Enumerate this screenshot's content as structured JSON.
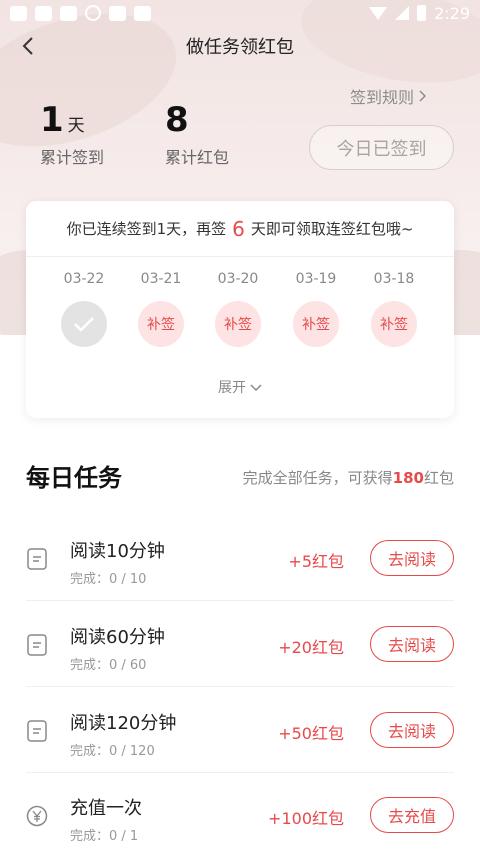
{
  "status_bar": {
    "time": "2:29"
  },
  "header": {
    "title": "做任务领红包"
  },
  "stats": {
    "days": {
      "value": "1",
      "unit": "天",
      "label": "累计签到"
    },
    "packets": {
      "value": "8",
      "label": "累计红包"
    }
  },
  "rules_label": "签到规则",
  "signed_button_label": "今日已签到",
  "checkin": {
    "message_pre": "你已连续签到1天，再签",
    "message_highlight": "6",
    "message_post": "天即可领取连签红包哦~",
    "days": [
      {
        "date": "03-22",
        "state": "done",
        "label": ""
      },
      {
        "date": "03-21",
        "state": "makeup",
        "label": "补签"
      },
      {
        "date": "03-20",
        "state": "makeup",
        "label": "补签"
      },
      {
        "date": "03-19",
        "state": "makeup",
        "label": "补签"
      },
      {
        "date": "03-18",
        "state": "makeup",
        "label": "补签"
      }
    ],
    "expand_label": "展开"
  },
  "tasks": {
    "title": "每日任务",
    "summary_pre": "完成全部任务，可获得",
    "summary_amount": "180",
    "summary_post": "红包",
    "items": [
      {
        "icon": "document-icon",
        "name": "阅读10分钟",
        "progress": "完成：0 / 10",
        "reward": "+5红包",
        "button": "去阅读"
      },
      {
        "icon": "document-icon",
        "name": "阅读60分钟",
        "progress": "完成：0 / 60",
        "reward": "+20红包",
        "button": "去阅读"
      },
      {
        "icon": "document-icon",
        "name": "阅读120分钟",
        "progress": "完成：0 / 120",
        "reward": "+50红包",
        "button": "去阅读"
      },
      {
        "icon": "yuan-icon",
        "name": "充值一次",
        "progress": "完成：0 / 1",
        "reward": "+100红包",
        "button": "去充值"
      }
    ]
  },
  "colors": {
    "accent": "#e84a4a",
    "hero_bg": "#f3e7e5"
  }
}
